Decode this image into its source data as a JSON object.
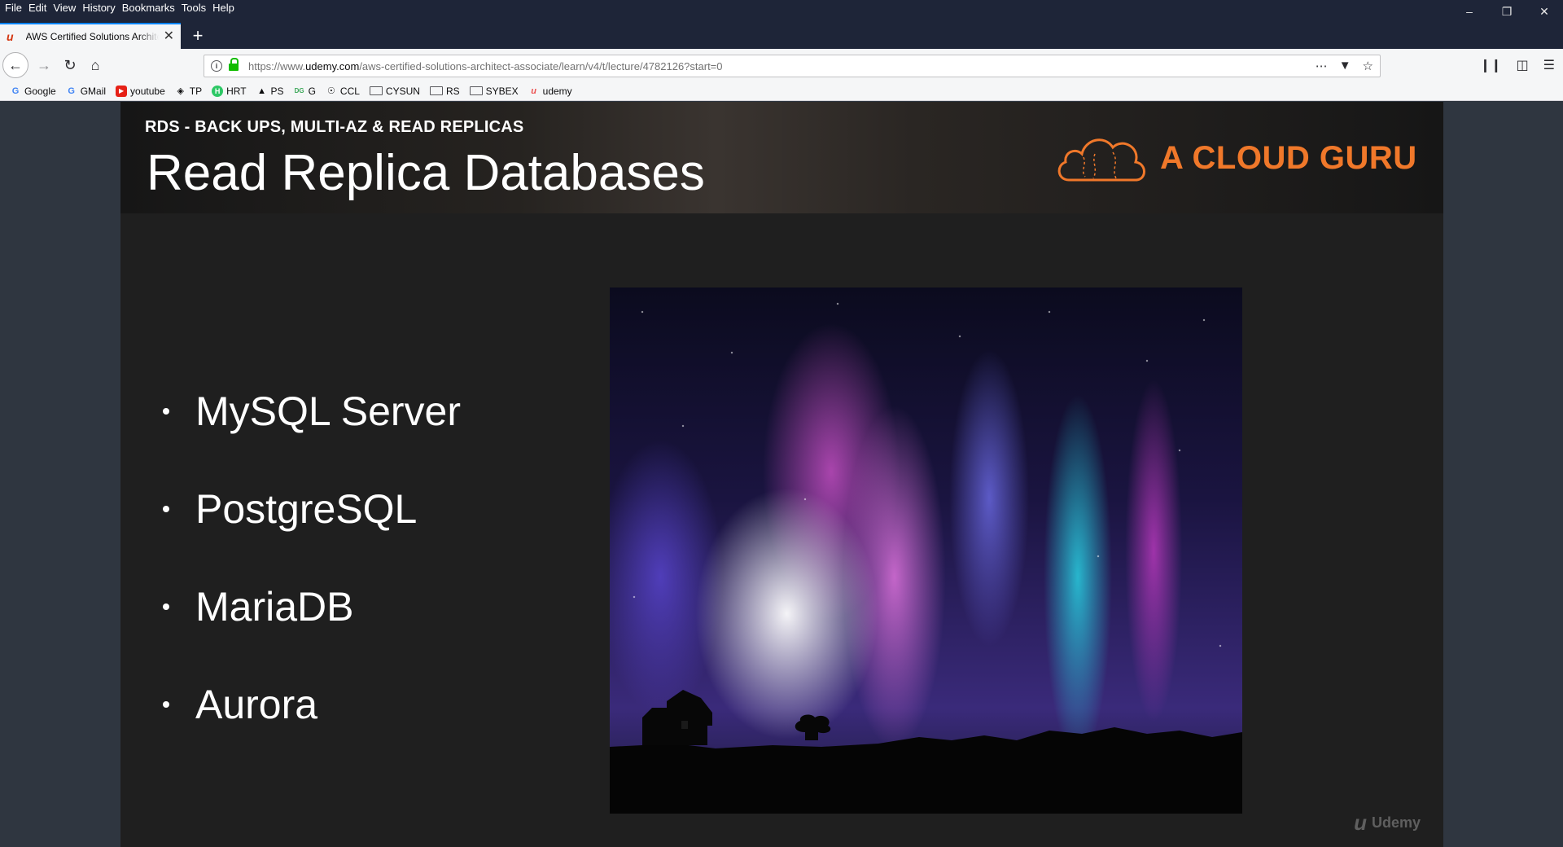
{
  "menu": {
    "items": [
      "File",
      "Edit",
      "View",
      "History",
      "Bookmarks",
      "Tools",
      "Help"
    ]
  },
  "window_controls": {
    "minimize": "–",
    "restore": "❐",
    "close": "✕"
  },
  "tab": {
    "title": "AWS Certified Solutions Architect",
    "close": "✕",
    "new_tab": "+"
  },
  "nav": {
    "url_prefix": "https://www.",
    "url_domain": "udemy.com",
    "url_path": "/aws-certified-solutions-architect-associate/learn/v4/t/lecture/4782126?start=0"
  },
  "bookmarks": [
    {
      "label": "Google",
      "icon": "google-icon"
    },
    {
      "label": "GMail",
      "icon": "google-icon"
    },
    {
      "label": "youtube",
      "icon": "youtube-icon"
    },
    {
      "label": "TP",
      "icon": "tp-icon"
    },
    {
      "label": "HRT",
      "icon": "hackerrank-icon"
    },
    {
      "label": "PS",
      "icon": "ps-icon"
    },
    {
      "label": "G",
      "icon": "g-icon"
    },
    {
      "label": "CCL",
      "icon": "ccl-icon"
    },
    {
      "label": "CYSUN",
      "icon": "folder-icon"
    },
    {
      "label": "RS",
      "icon": "folder-icon"
    },
    {
      "label": "SYBEX",
      "icon": "folder-icon"
    },
    {
      "label": "udemy",
      "icon": "udemy-icon"
    }
  ],
  "slide": {
    "subtitle": "RDS - BACK UPS, MULTI-AZ & READ REPLICAS",
    "title": "Read Replica Databases",
    "brand": "A CLOUD GURU",
    "bullets": [
      "MySQL Server",
      "PostgreSQL",
      "MariaDB",
      "Aurora"
    ],
    "watermark": "Udemy"
  },
  "colors": {
    "brand_orange": "#f0782a",
    "titlebar": "#1e2538",
    "slide_bg": "#1f1f1f",
    "page_bg": "#2f3640"
  }
}
